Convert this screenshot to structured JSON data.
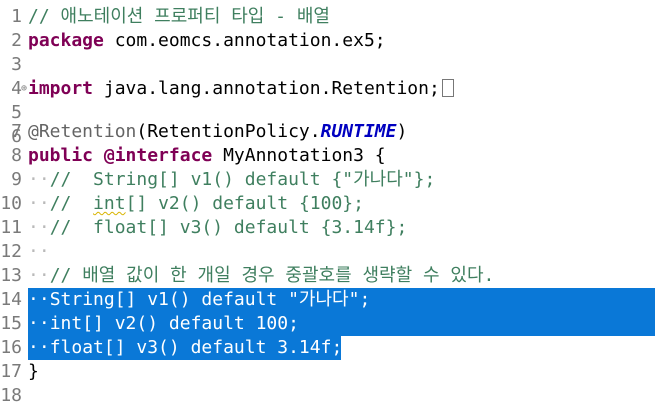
{
  "editor": {
    "lines": [
      {
        "num": "1",
        "text": "// 애노테이션 프로퍼티 타입 - 배열"
      },
      {
        "num": "2",
        "kw": "package",
        "text": " com.eomcs.annotation.ex5;"
      },
      {
        "num": "3",
        "text": ""
      },
      {
        "num": "4",
        "kw": "import",
        "text": " java.lang.annotation.Retention;"
      },
      {
        "num": "5",
        "text": ""
      },
      {
        "num": "6",
        "text": ""
      },
      {
        "num": "7",
        "anno": "@Retention",
        "pre": "(RetentionPolicy.",
        "italic": "RUNTIME",
        "post": ")"
      },
      {
        "num": "8",
        "kw1": "public",
        "kw2": "@interface",
        "text": " MyAnnotation3 {"
      },
      {
        "num": "9",
        "text": "//  String[] v1() default {\"가나다\"};"
      },
      {
        "num": "10",
        "pre": "//  ",
        "squig": "int",
        "text": "[] v2() default {100};"
      },
      {
        "num": "11",
        "text": "//  float[] v3() default {3.14f};"
      },
      {
        "num": "12",
        "text": ""
      },
      {
        "num": "13",
        "text": "// 배열 값이 한 개일 경우 중괄호를 생략할 수 있다."
      },
      {
        "num": "14",
        "text": "String[] v1() default \"가나다\";"
      },
      {
        "num": "15",
        "text": "int[] v2() default 100;"
      },
      {
        "num": "16",
        "text": "float[] v3() default 3.14f;"
      },
      {
        "num": "17",
        "text": "}"
      },
      {
        "num": "18",
        "text": ""
      }
    ],
    "fold_marker_line4": "⊕"
  }
}
